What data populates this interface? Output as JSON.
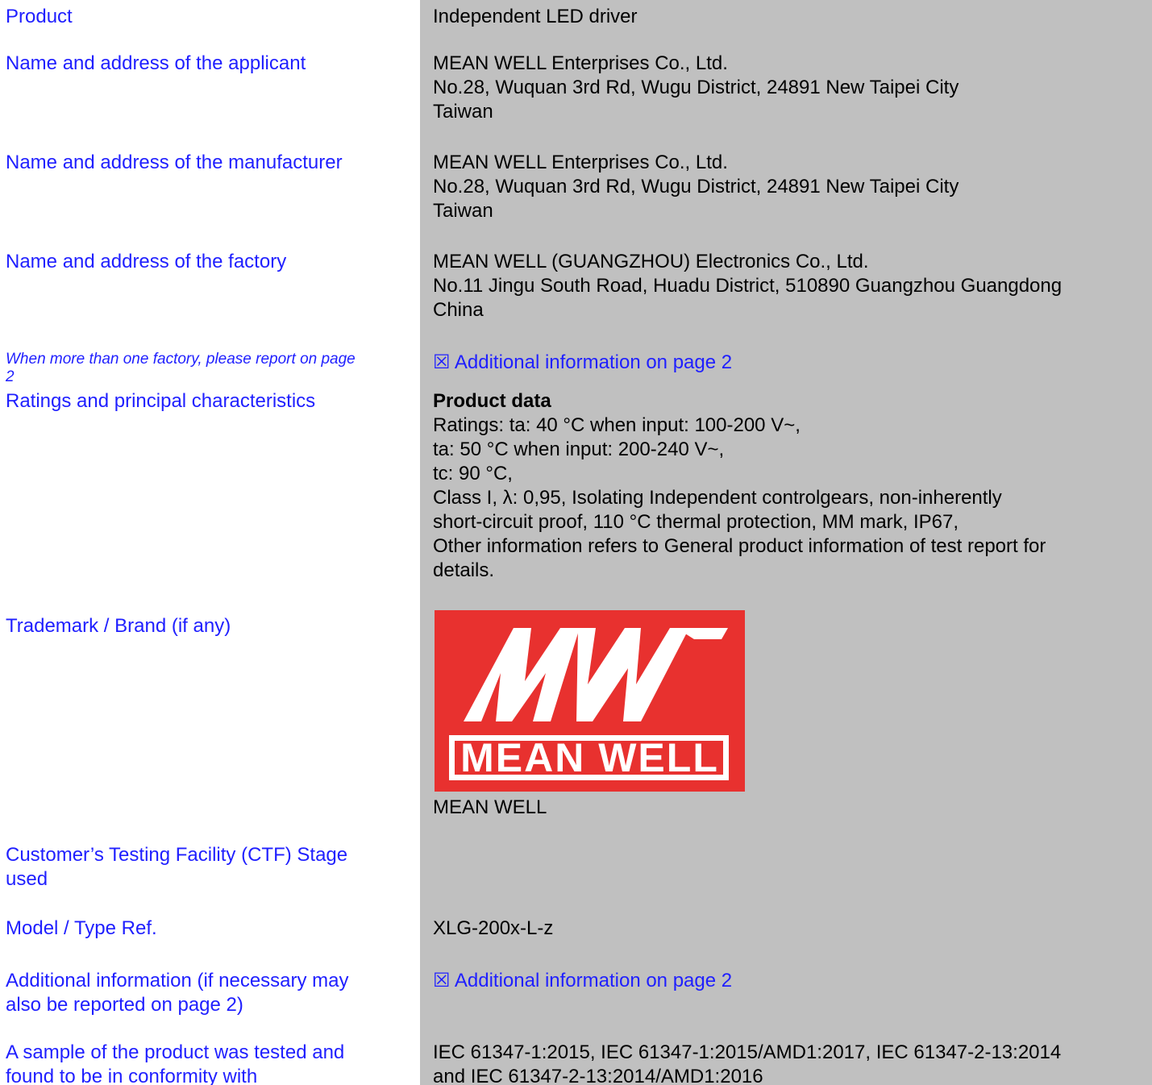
{
  "fields": [
    {
      "label": "Product",
      "value": [
        "Independent LED driver"
      ]
    },
    {
      "label": "Name and address of the applicant",
      "value": [
        "MEAN WELL Enterprises Co., Ltd.",
        "No.28, Wuquan 3rd Rd, Wugu District, 24891  New Taipei City",
        "Taiwan"
      ]
    },
    {
      "label": "Name and address of the manufacturer",
      "value": [
        "MEAN WELL Enterprises Co., Ltd.",
        "No.28, Wuquan 3rd Rd, Wugu District, 24891  New Taipei City",
        "Taiwan"
      ]
    },
    {
      "label": "Name and address of the factory",
      "value": [
        "MEAN WELL (GUANGZHOU) Electronics Co., Ltd.",
        "No.11 Jingu South Road, Huadu District, 510890  Guangzhou Guangdong",
        "China"
      ]
    },
    {
      "label": [
        "When more than one factory, please report on page",
        "2"
      ],
      "value": "☒ Additional information on page 2"
    },
    {
      "label": "Ratings and principal characteristics",
      "heading": "Product data",
      "value": [
        "Ratings: ta: 40 °C when input: 100-200 V~,",
        "ta: 50 °C when input: 200-240 V~,",
        "tc: 90 °C,",
        "Class I, λ: 0,95, Isolating Independent controlgears, non-inherently",
        "short-circuit proof, 110 °C thermal protection, MM mark, IP67,",
        "Other information refers to General product information of test report for",
        "details."
      ]
    },
    {
      "label": "Trademark / Brand (if any)",
      "logo_text": "MEAN WELL",
      "value": "MEAN WELL"
    },
    {
      "label": [
        "Customer’s Testing Facility (CTF) Stage",
        "used"
      ],
      "value": ""
    },
    {
      "label": "Model / Type Ref.",
      "value": "XLG-200x-L-z"
    },
    {
      "label": [
        "Additional information (if necessary may",
        "also be reported on page 2)"
      ],
      "value": "☒ Additional information on page 2"
    },
    {
      "label": [
        "A sample of the product was tested and",
        "found to be in conformity with"
      ],
      "value": [
        "IEC 61347-1:2015, IEC 61347-1:2015/AMD1:2017, IEC 61347-2-13:2014",
        "and IEC 61347-2-13:2014/AMD1:2016"
      ]
    }
  ],
  "colors": {
    "label_blue": "#1f1fff",
    "panel_gray": "#c0c0c0",
    "logo_red": "#e8312f"
  }
}
